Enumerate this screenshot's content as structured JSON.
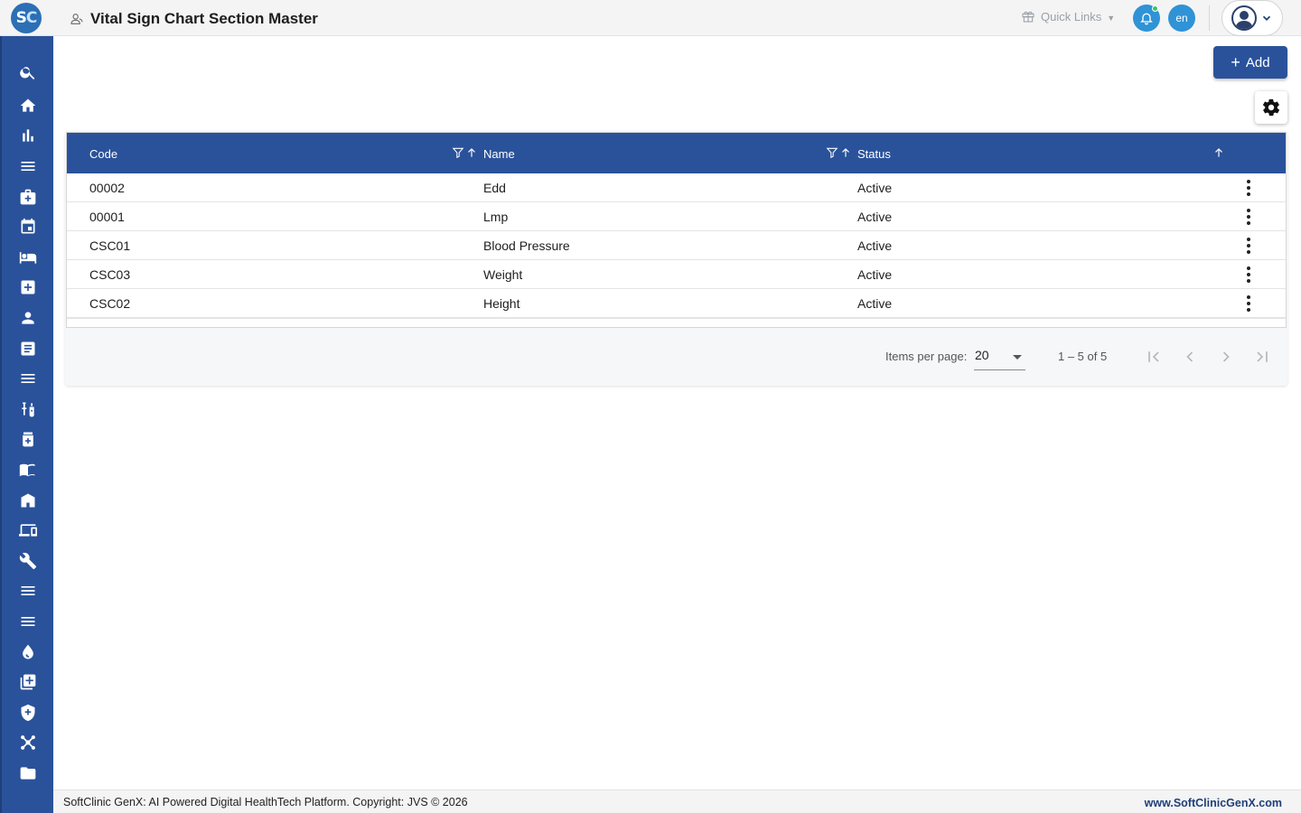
{
  "header": {
    "logo_s": "S",
    "logo_c": "C",
    "title": "Vital Sign Chart Section Master",
    "quick_links_label": "Quick Links",
    "language": "en"
  },
  "sidebar": {
    "items": [
      {
        "name": "search",
        "icon": "search-icon"
      },
      {
        "name": "home",
        "icon": "home-icon"
      },
      {
        "name": "analytics",
        "icon": "bar-chart-icon"
      },
      {
        "name": "menu-1",
        "icon": "menu-icon"
      },
      {
        "name": "medical-kit",
        "icon": "medical-bag-icon"
      },
      {
        "name": "calendar",
        "icon": "calendar-icon"
      },
      {
        "name": "bed",
        "icon": "bed-icon"
      },
      {
        "name": "medical-services",
        "icon": "plus-box-icon"
      },
      {
        "name": "person",
        "icon": "person-icon"
      },
      {
        "name": "reports",
        "icon": "document-icon"
      },
      {
        "name": "menu-2",
        "icon": "menu-icon"
      },
      {
        "name": "lab",
        "icon": "lab-icon"
      },
      {
        "name": "pharmacy",
        "icon": "medicine-bottle-icon"
      },
      {
        "name": "library",
        "icon": "book-icon"
      },
      {
        "name": "store",
        "icon": "store-icon"
      },
      {
        "name": "devices",
        "icon": "devices-icon"
      },
      {
        "name": "settings-tools",
        "icon": "wrench-icon"
      },
      {
        "name": "menu-3",
        "icon": "menu-icon"
      },
      {
        "name": "menu-4",
        "icon": "menu-icon"
      },
      {
        "name": "blood-bank",
        "icon": "drop-icon"
      },
      {
        "name": "add-library",
        "icon": "add-library-icon"
      },
      {
        "name": "security",
        "icon": "shield-icon"
      },
      {
        "name": "network",
        "icon": "network-icon"
      },
      {
        "name": "folder",
        "icon": "folder-icon"
      }
    ]
  },
  "toolbar": {
    "add_label": "Add"
  },
  "table": {
    "columns": [
      "Code",
      "Name",
      "Status"
    ],
    "rows": [
      {
        "code": "00002",
        "name": "Edd",
        "status": "Active"
      },
      {
        "code": "00001",
        "name": "Lmp",
        "status": "Active"
      },
      {
        "code": "CSC01",
        "name": "Blood Pressure",
        "status": "Active"
      },
      {
        "code": "CSC03",
        "name": "Weight",
        "status": "Active"
      },
      {
        "code": "CSC02",
        "name": "Height",
        "status": "Active"
      }
    ]
  },
  "paginator": {
    "items_per_page_label": "Items per page:",
    "items_per_page_value": "20",
    "range_label": "1 – 5 of 5"
  },
  "footer": {
    "copyright": "SoftClinic GenX: AI Powered Digital HealthTech Platform. Copyright: JVS © 2026",
    "website": "www.SoftClinicGenX.com"
  },
  "colors": {
    "primary": "#2a529b",
    "accent": "#2f93d6",
    "online": "#3cc46a"
  }
}
